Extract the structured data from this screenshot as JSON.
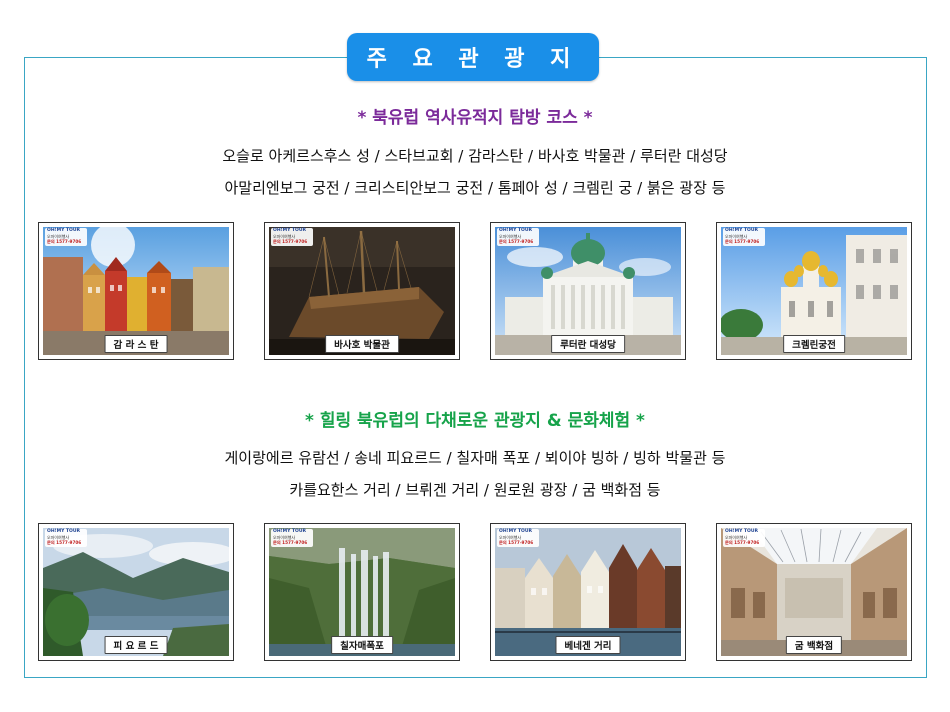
{
  "title": "주 요 관 광 지",
  "section1": {
    "heading": "* 북유럽 역사유적지 탐방 코스 *",
    "heading_color": "#7b2a9a",
    "line1": "오슬로 아케르스후스 성 / 스타브교회 / 감라스탄 / 바사호 박물관 / 루터란 대성당",
    "line2": "아말리엔보그 궁전 / 크리스티안보그 궁전 / 톰페아 성 / 크렘린 궁 / 붉은 광장 등",
    "photos": [
      {
        "caption": "감 라 스 탄"
      },
      {
        "caption": "바사호 박물관"
      },
      {
        "caption": "루터란 대성당"
      },
      {
        "caption": "크렘린궁전"
      }
    ]
  },
  "section2": {
    "heading": "* 힐링 북유럽의 다채로운 관광지 & 문화체험 *",
    "heading_color": "#16a34a",
    "line1": "게이랑에르 유람선 / 송네 피요르드 / 칠자매 폭포 / 뵈이야 빙하 / 빙하 박물관 등",
    "line2": "카를요한스 거리 / 브뤼겐 거리 / 원로원 광장 / 굼 백화점 등",
    "photos": [
      {
        "caption": "피 요 르 드"
      },
      {
        "caption": "칠자매폭포"
      },
      {
        "caption": "베네겐 거리"
      },
      {
        "caption": "굼 백화점"
      }
    ]
  },
  "logo": {
    "brand": "OH!MY TOUR",
    "sub": "오마이여행사",
    "phone": "문의 1577-9706"
  },
  "colors": {
    "badge": "#1a8fe8",
    "frame_border": "#3aa6c4"
  }
}
